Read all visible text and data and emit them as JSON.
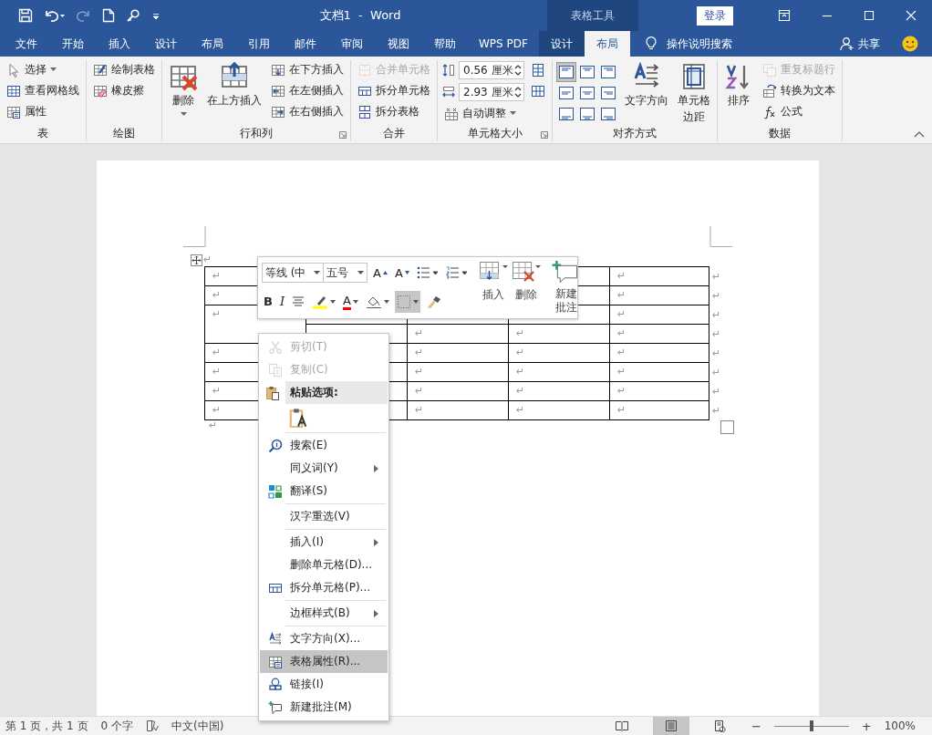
{
  "window": {
    "title": "文档1  -  Word",
    "context_title": "表格工具",
    "sign_in": "登录"
  },
  "tabs": [
    {
      "label": "文件",
      "selected": false,
      "kind": "normal"
    },
    {
      "label": "开始",
      "selected": false,
      "kind": "normal"
    },
    {
      "label": "插入",
      "selected": false,
      "kind": "normal"
    },
    {
      "label": "设计",
      "selected": false,
      "kind": "normal"
    },
    {
      "label": "布局",
      "selected": false,
      "kind": "normal"
    },
    {
      "label": "引用",
      "selected": false,
      "kind": "normal"
    },
    {
      "label": "邮件",
      "selected": false,
      "kind": "normal"
    },
    {
      "label": "审阅",
      "selected": false,
      "kind": "normal"
    },
    {
      "label": "视图",
      "selected": false,
      "kind": "normal"
    },
    {
      "label": "帮助",
      "selected": false,
      "kind": "normal"
    },
    {
      "label": "WPS PDF",
      "selected": false,
      "kind": "normal"
    },
    {
      "label": "设计",
      "selected": false,
      "kind": "contextual"
    },
    {
      "label": "布局",
      "selected": true,
      "kind": "contextual"
    }
  ],
  "tell_me": "操作说明搜索",
  "share": "共享",
  "ribbon": {
    "groups": [
      {
        "label": "表",
        "columns": [
          [
            {
              "kind": "small",
              "label": "选择",
              "dropdown": true,
              "disabled": false
            },
            {
              "kind": "small",
              "label": "查看网格线",
              "disabled": false
            },
            {
              "kind": "small",
              "label": "属性",
              "disabled": false
            }
          ]
        ]
      },
      {
        "label": "绘图",
        "columns": [
          [
            {
              "kind": "small",
              "label": "绘制表格",
              "disabled": false
            },
            {
              "kind": "small",
              "label": "橡皮擦",
              "disabled": false
            }
          ]
        ]
      },
      {
        "label": "行和列",
        "launcher": true,
        "columns": [
          [
            {
              "kind": "large",
              "label": "删除",
              "dropdown": true,
              "disabled": false
            }
          ],
          [
            {
              "kind": "large",
              "label": "在上方插入",
              "disabled": false
            }
          ],
          [
            {
              "kind": "small",
              "label": "在下方插入",
              "disabled": false
            },
            {
              "kind": "small",
              "label": "在左侧插入",
              "disabled": false
            },
            {
              "kind": "small",
              "label": "在右侧插入",
              "disabled": false
            }
          ]
        ]
      },
      {
        "label": "合并",
        "columns": [
          [
            {
              "kind": "small",
              "label": "合并单元格",
              "disabled": true
            },
            {
              "kind": "small",
              "label": "拆分单元格",
              "disabled": false
            },
            {
              "kind": "small",
              "label": "拆分表格",
              "disabled": false
            }
          ]
        ]
      },
      {
        "label": "单元格大小",
        "launcher": true,
        "columns": [
          [
            {
              "kind": "spin",
              "value": "0.56 厘米",
              "disabled": false
            },
            {
              "kind": "spin",
              "value": "2.93 厘米",
              "disabled": false
            },
            {
              "kind": "small",
              "label": "自动调整",
              "dropdown": true,
              "disabled": false
            }
          ],
          [
            {
              "kind": "icon"
            },
            {
              "kind": "icon"
            }
          ]
        ]
      },
      {
        "label": "对齐方式",
        "columns": [
          [
            {
              "kind": "align",
              "cells": [
                {
                  "selected": true
                },
                {
                  "selected": false
                },
                {
                  "selected": false
                },
                {
                  "selected": false
                },
                {
                  "selected": false
                },
                {
                  "selected": false
                },
                {
                  "selected": false
                },
                {
                  "selected": false
                },
                {
                  "selected": false
                }
              ]
            }
          ],
          [
            {
              "kind": "large",
              "label": "文字方向",
              "disabled": false
            }
          ],
          [
            {
              "kind": "large",
              "label": [
                "单元格",
                "边距"
              ],
              "disabled": false
            }
          ]
        ]
      },
      {
        "label": "数据",
        "columns": [
          [
            {
              "kind": "large",
              "label": "排序",
              "disabled": false
            }
          ],
          [
            {
              "kind": "small",
              "label": "重复标题行",
              "disabled": true
            },
            {
              "kind": "small",
              "label": "转换为文本",
              "disabled": false
            },
            {
              "kind": "small",
              "label": "公式",
              "disabled": false
            }
          ]
        ]
      }
    ]
  },
  "document": {
    "handle_mark": "↵",
    "after_table_mark": "↵"
  },
  "table": {
    "rows": [
      {
        "cells": [
          "↵",
          null,
          null,
          null,
          "↵"
        ],
        "row_end": "↵"
      },
      {
        "cells": [
          "↵",
          null,
          null,
          null,
          "↵"
        ],
        "row_end": "↵"
      },
      {
        "cells": [
          {
            "text": "↵",
            "rowspan": 2
          },
          null,
          null,
          null,
          "↵"
        ],
        "row_end": "↵"
      },
      {
        "cells": [
          null,
          "↵",
          "↵",
          "↵"
        ],
        "row_end": "↵"
      },
      {
        "cells": [
          "↵",
          null,
          "↵",
          "↵",
          "↵"
        ],
        "row_end": "↵"
      },
      {
        "cells": [
          "↵",
          null,
          "↵",
          "↵",
          "↵"
        ],
        "row_end": "↵"
      },
      {
        "cells": [
          "↵",
          null,
          "↵",
          "↵",
          "↵"
        ],
        "row_end": "↵"
      },
      {
        "cells": [
          "↵",
          null,
          "↵",
          "↵",
          "↵"
        ],
        "row_end": "↵"
      }
    ]
  },
  "mini_toolbar": {
    "font": "等线 (中",
    "size": "五号",
    "row1": [
      {
        "kind": "grow",
        "glyph": "A"
      },
      {
        "kind": "shrink",
        "glyph": "A"
      },
      {
        "kind": "bullets"
      },
      {
        "kind": "numbering"
      }
    ],
    "row2": [
      {
        "kind": "bold",
        "glyph": "B",
        "selected": false
      },
      {
        "kind": "italic",
        "glyph": "I",
        "selected": false
      },
      {
        "kind": "center",
        "selected": false
      },
      {
        "kind": "highlight",
        "color": "#ffff00",
        "selected": false
      },
      {
        "kind": "font-color",
        "glyph": "A",
        "color": "#ff0000",
        "selected": false
      },
      {
        "kind": "shading",
        "selected": false
      },
      {
        "kind": "borders",
        "selected": true
      },
      {
        "kind": "painter",
        "selected": false
      }
    ],
    "large": [
      {
        "kind": "insert",
        "label": "插入"
      },
      {
        "kind": "delete",
        "label": "删除"
      },
      {
        "kind": "comment",
        "label": [
          "新建",
          "批注"
        ]
      }
    ]
  },
  "context_menu": {
    "items": [
      {
        "kind": "item",
        "label": "剪切(T)",
        "disabled": true,
        "selected": false
      },
      {
        "kind": "item",
        "label": "复制(C)",
        "disabled": true,
        "selected": false
      },
      {
        "kind": "header",
        "label": "粘贴选项:",
        "disabled": false,
        "selected": false
      },
      {
        "kind": "paste-option",
        "selected": false
      },
      {
        "kind": "separator"
      },
      {
        "kind": "item",
        "label": "搜索(E)",
        "disabled": false,
        "selected": false
      },
      {
        "kind": "item",
        "label": "同义词(Y)",
        "submenu": true,
        "disabled": false,
        "selected": false
      },
      {
        "kind": "item",
        "label": "翻译(S)",
        "disabled": false,
        "selected": false
      },
      {
        "kind": "separator"
      },
      {
        "kind": "item",
        "label": "汉字重选(V)",
        "disabled": false,
        "selected": false
      },
      {
        "kind": "separator"
      },
      {
        "kind": "item",
        "label": "插入(I)",
        "submenu": true,
        "disabled": false,
        "selected": false
      },
      {
        "kind": "item",
        "label": "删除单元格(D)...",
        "disabled": false,
        "selected": false
      },
      {
        "kind": "item",
        "label": "拆分单元格(P)...",
        "disabled": false,
        "selected": false
      },
      {
        "kind": "separator"
      },
      {
        "kind": "item",
        "label": "边框样式(B)",
        "submenu": true,
        "disabled": false,
        "selected": false
      },
      {
        "kind": "separator"
      },
      {
        "kind": "item",
        "label": "文字方向(X)...",
        "disabled": false,
        "selected": false
      },
      {
        "kind": "item",
        "label": "表格属性(R)...",
        "disabled": false,
        "selected": true
      },
      {
        "kind": "item",
        "label": "链接(I)",
        "disabled": false,
        "selected": false
      },
      {
        "kind": "item",
        "label": "新建批注(M)",
        "disabled": false,
        "selected": false
      }
    ]
  },
  "status_bar": {
    "page": "第 1 页，共 1 页",
    "words": "0 个字",
    "language": "中文(中国)",
    "views": [
      {
        "selected": false
      },
      {
        "selected": true
      },
      {
        "selected": false
      }
    ],
    "zoom_minus": "−",
    "zoom_plus": "+",
    "zoom": {
      "level": 0.5,
      "reading": "100%"
    }
  }
}
